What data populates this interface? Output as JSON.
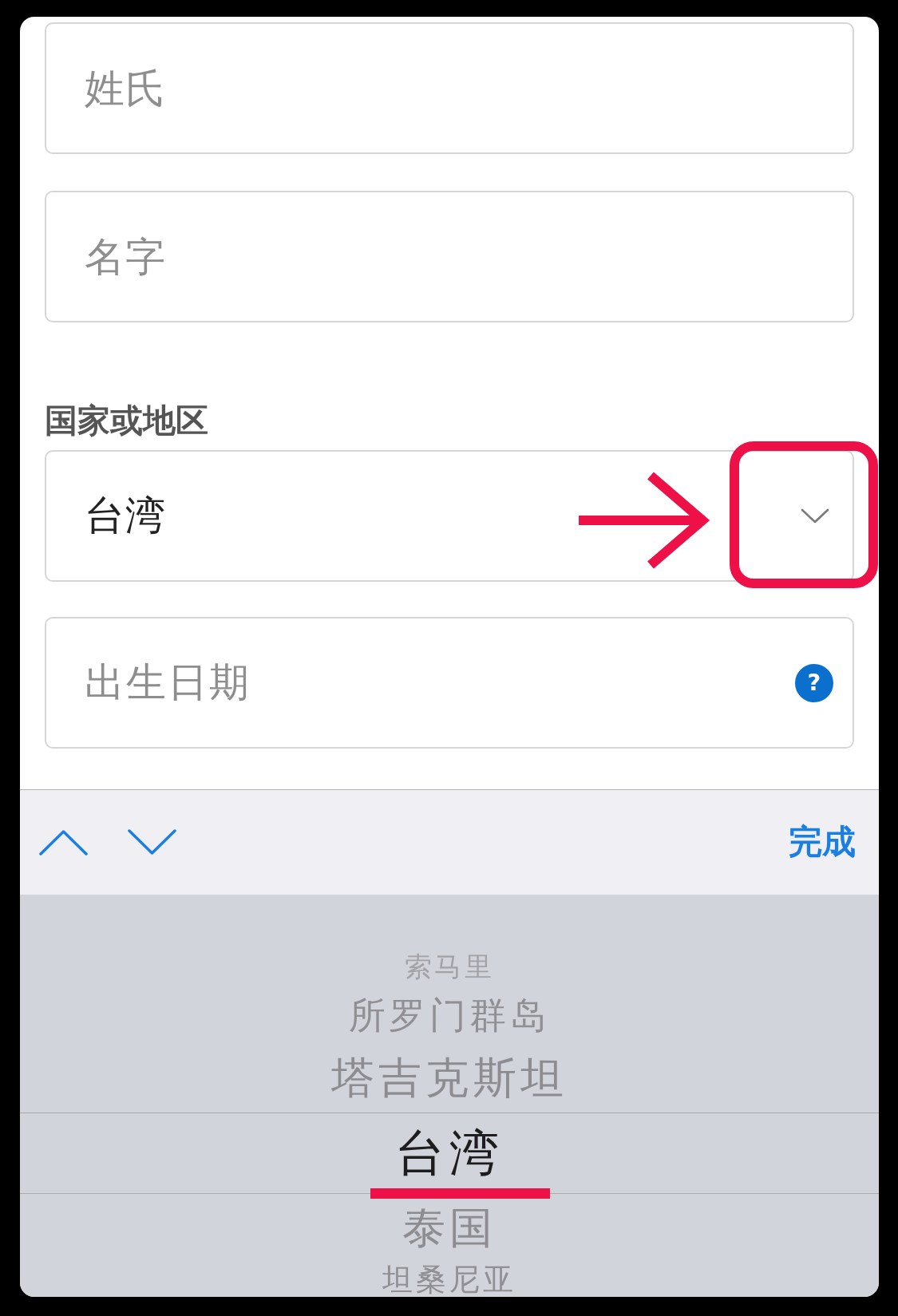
{
  "form": {
    "fields": [
      {
        "kind": "text",
        "placeholder": "姓氏"
      },
      {
        "kind": "text",
        "placeholder": "名字"
      },
      {
        "kind": "select",
        "label": "国家或地区",
        "value": "台湾"
      },
      {
        "kind": "date",
        "placeholder": "出生日期",
        "help": "?"
      }
    ]
  },
  "keyboard_toolbar": {
    "done": "完成"
  },
  "picker": {
    "items": [
      {
        "label": "索马里",
        "selected": false
      },
      {
        "label": "所罗门群岛",
        "selected": false
      },
      {
        "label": "塔吉克斯坦",
        "selected": false
      },
      {
        "label": "台湾",
        "selected": true
      },
      {
        "label": "泰国",
        "selected": false
      },
      {
        "label": "坦桑尼亚",
        "selected": false
      }
    ]
  }
}
